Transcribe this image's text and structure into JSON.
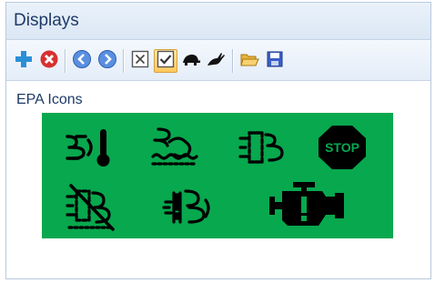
{
  "window": {
    "title": "Displays"
  },
  "toolbar": {
    "buttons": [
      {
        "name": "add-icon",
        "tooltip": ""
      },
      {
        "name": "delete-icon",
        "tooltip": ""
      },
      {
        "name": "back-icon",
        "tooltip": ""
      },
      {
        "name": "forward-icon",
        "tooltip": ""
      },
      {
        "name": "uncheck-icon",
        "tooltip": ""
      },
      {
        "name": "check-icon",
        "tooltip": ""
      },
      {
        "name": "turtle-icon",
        "tooltip": ""
      },
      {
        "name": "rabbit-icon",
        "tooltip": ""
      },
      {
        "name": "open-folder-icon",
        "tooltip": ""
      },
      {
        "name": "save-icon",
        "tooltip": ""
      }
    ]
  },
  "section": {
    "label": "EPA Icons",
    "background_color": "#08a84e",
    "icon_color": "#000000",
    "icons": [
      "exhaust-temperature-icon",
      "exhaust-regeneration-icon",
      "dpf-icon",
      "stop-icon",
      "regeneration-inhibit-icon",
      "def-warning-icon",
      "check-engine-icon"
    ],
    "stop_text": "STOP"
  }
}
